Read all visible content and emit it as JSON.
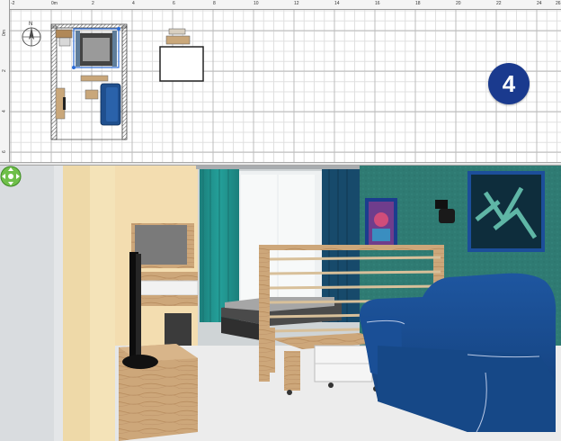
{
  "plan": {
    "ruler_h_labels": [
      "-2",
      "0m",
      "2",
      "4",
      "6",
      "8",
      "10",
      "12",
      "14",
      "16",
      "18",
      "20",
      "22",
      "24",
      "26"
    ],
    "ruler_v_labels": [
      "0m",
      "2",
      "4",
      "6"
    ],
    "compass_letter": "N"
  },
  "step_badge": {
    "number": "4",
    "color": "#1a3a8e"
  },
  "view3d": {
    "navigation_icon": "navigation-arrows-icon",
    "colors": {
      "wall_teal": "#2e7a74",
      "curtain_teal": "#1d8a86",
      "curtain_navy": "#174a6b",
      "sofa_blue": "#154a92",
      "wood": "#c8a57a",
      "floor": "#ebebeb"
    }
  }
}
